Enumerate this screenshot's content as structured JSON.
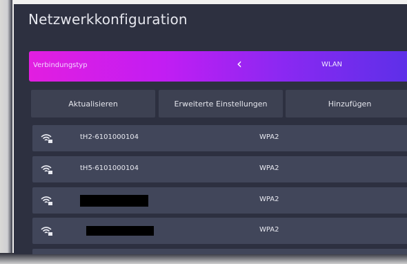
{
  "page": {
    "title": "Netzwerkkonfiguration"
  },
  "connection": {
    "label": "Verbindungstyp",
    "value": "WLAN",
    "prev_icon": "chevron-left-icon",
    "next_icon": "chevron-right-icon"
  },
  "actions": {
    "refresh": "Aktualisieren",
    "advanced": "Erweiterte Einstellungen",
    "add": "Hinzufügen"
  },
  "networks": [
    {
      "ssid": "tH2-6101000104",
      "security": "WPA2",
      "icon": "wifi-lock-icon"
    },
    {
      "ssid": "tH5-6101000104",
      "security": "WPA2",
      "icon": "wifi-lock-icon"
    },
    {
      "ssid": "",
      "security": "WPA2",
      "icon": "wifi-lock-icon",
      "redacted": true
    },
    {
      "ssid": "",
      "security": "WPA2",
      "icon": "wifi-lock-icon",
      "redacted": true
    }
  ],
  "colors": {
    "background": "#2d3040",
    "row": "#41465a",
    "button": "#3d4152",
    "accent_start": "#e21ee0",
    "accent_end": "#5b30e8",
    "text": "#e9eaf1"
  }
}
